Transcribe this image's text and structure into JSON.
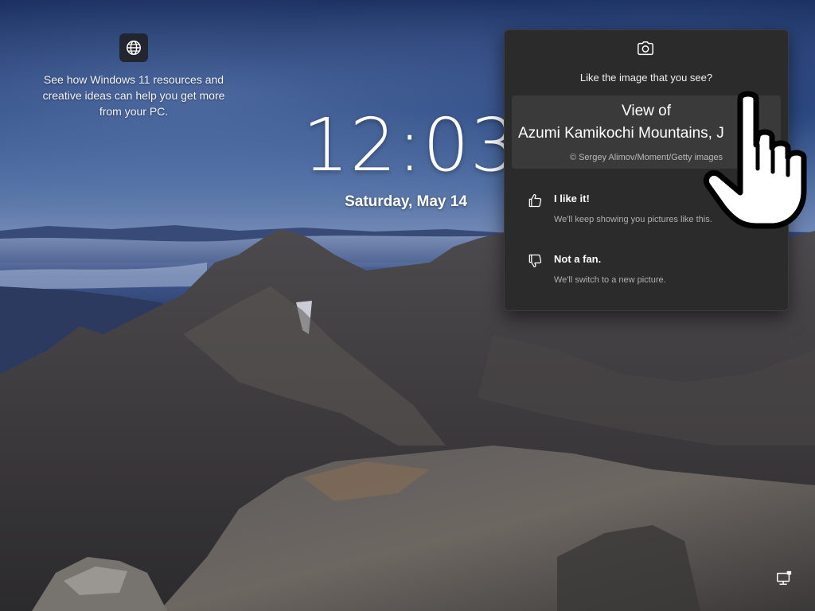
{
  "spotlight": {
    "icon": "globe-icon",
    "text": "See how Windows 11 resources and creative ideas can help you get more from your PC."
  },
  "lockscreen": {
    "time": "12:03",
    "date": "Saturday, May 14"
  },
  "flyout": {
    "camera_icon": "camera-icon",
    "question": "Like the image that you see?",
    "image_title_line1": "View of",
    "image_title_line2": "Azumi Kamikochi Mountains, J",
    "image_credit": "© Sergey Alimov/Moment/Getty images",
    "like": {
      "icon": "thumbs-up-icon",
      "title": "I like it!",
      "description": "We'll keep showing you pictures like this."
    },
    "not_fan": {
      "icon": "thumbs-down-icon",
      "title": "Not a fan.",
      "description": "We'll switch to a new picture."
    }
  },
  "system_tray": {
    "network_icon": "network-icon"
  },
  "cursor": {
    "icon": "hand-pointer-icon"
  },
  "colors": {
    "flyout_bg": "#2b2b2b",
    "card_bg": "#3a3a3a",
    "sky_top": "#162a5a",
    "rock": "#5a5550"
  }
}
